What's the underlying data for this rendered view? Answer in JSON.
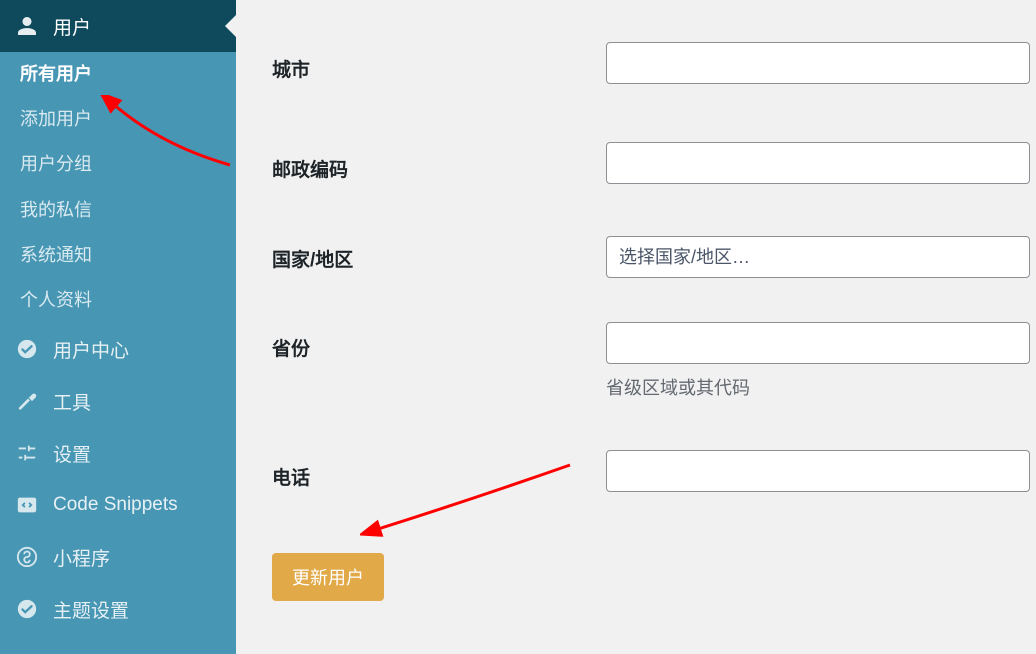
{
  "sidebar": {
    "users": {
      "label": "用户"
    },
    "submenu": {
      "all": "所有用户",
      "add": "添加用户",
      "groups": "用户分组",
      "pm": "我的私信",
      "sysnotice": "系统通知",
      "profile": "个人资料"
    },
    "usercenter": {
      "label": "用户中心"
    },
    "tools": {
      "label": "工具"
    },
    "settings": {
      "label": "设置"
    },
    "snippets": {
      "label": "Code Snippets"
    },
    "miniapp": {
      "label": "小程序"
    },
    "theme": {
      "label": "主题设置"
    }
  },
  "form": {
    "city": {
      "label": "城市",
      "value": ""
    },
    "postcode": {
      "label": "邮政编码",
      "value": ""
    },
    "country": {
      "label": "国家/地区",
      "placeholder": "选择国家/地区…"
    },
    "province": {
      "label": "省份",
      "value": "",
      "help": "省级区域或其代码"
    },
    "phone": {
      "label": "电话",
      "value": ""
    },
    "submit": "更新用户"
  }
}
